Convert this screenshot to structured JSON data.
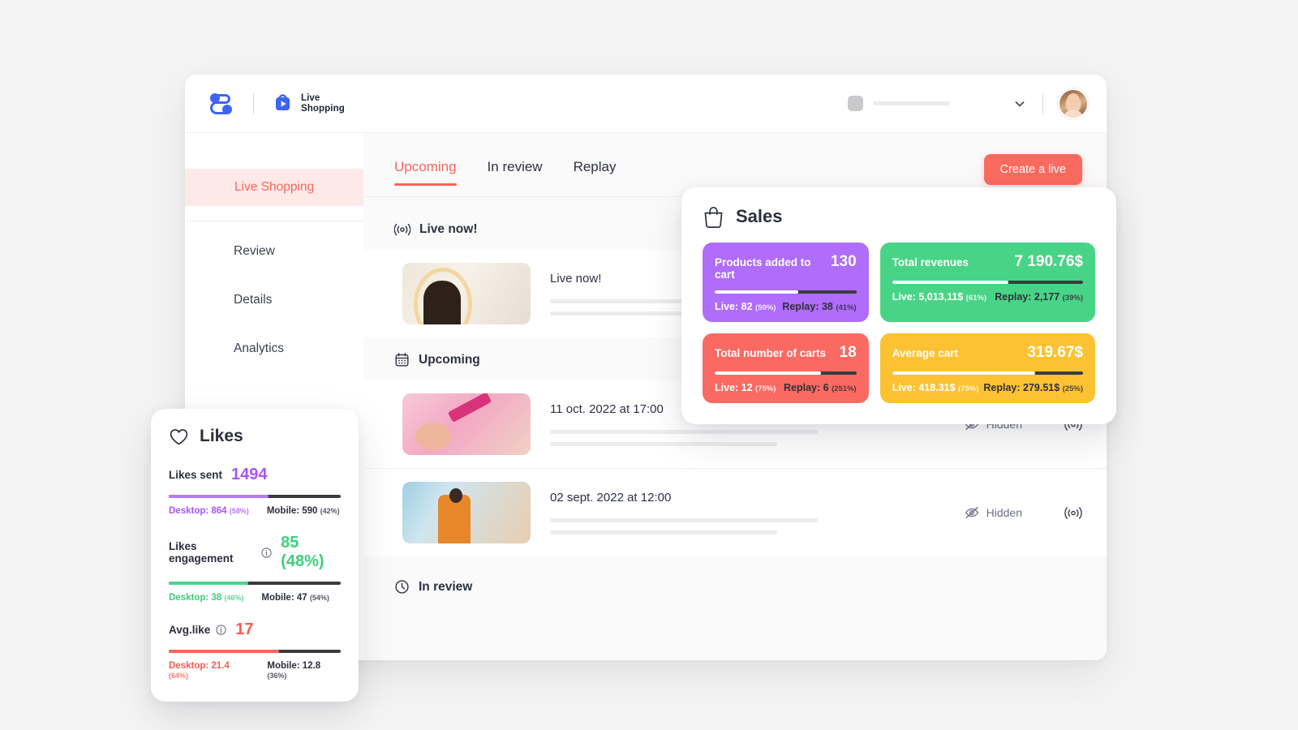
{
  "topbar": {
    "brand_icon": "shopify-style-logo",
    "product_title": "Live\nShopping",
    "product_icon": "live-play-bag-icon",
    "store_selector_icon": "store-thumbnail-placeholder",
    "chevron_icon": "chevron-down-icon",
    "avatar_icon": "user-avatar"
  },
  "sidebar": {
    "primary": {
      "label": "Live Shopping"
    },
    "items": [
      {
        "label": "Review"
      },
      {
        "label": "Details"
      },
      {
        "label": "Analytics"
      }
    ]
  },
  "content": {
    "create_live_label": "Create a live",
    "tabs": [
      {
        "label": "Upcoming",
        "active": true
      },
      {
        "label": "In review",
        "active": false
      },
      {
        "label": "Replay",
        "active": false
      }
    ],
    "live_now_section": {
      "icon": "broadcast-icon",
      "title": "Live now!",
      "row": {
        "title": "Live now!",
        "thumbnail": "woman-with-eyeshadow-palette"
      }
    },
    "upcoming_section": {
      "icon": "calendar-icon",
      "title": "Upcoming",
      "rows": [
        {
          "title": "11 oct. 2022 at 17:00",
          "thumbnail": "pink-makeup-brush-powder",
          "visibility_label": "Hidden",
          "visibility_icon": "eye-off-icon",
          "broadcast_icon": "broadcast-icon"
        },
        {
          "title": "02 sept. 2022 at 12:00",
          "thumbnail": "woman-in-clothing-store",
          "visibility_label": "Hidden",
          "visibility_icon": "eye-off-icon",
          "broadcast_icon": "broadcast-icon"
        }
      ]
    },
    "in_review_section": {
      "icon": "clock-icon",
      "title": "In review"
    }
  },
  "sales_card": {
    "icon": "shopping-bag-icon",
    "title": "Sales",
    "tiles": [
      {
        "label": "Products added to cart",
        "value": "130",
        "color": "#b06cfa",
        "bar_fill_pct": 59,
        "live_label": "Live: 82",
        "live_pct": "(59%)",
        "replay_label": "Replay: 38",
        "replay_pct": "(41%)"
      },
      {
        "label": "Total revenues",
        "value": "7 190.76$",
        "color": "#48d486",
        "bar_fill_pct": 61,
        "live_label": "Live: 5,013,11$",
        "live_pct": "(61%)",
        "replay_label": "Replay: 2,177",
        "replay_pct": "(39%)"
      },
      {
        "label": "Total number of carts",
        "value": "18",
        "color": "#fb6a62",
        "bar_fill_pct": 75,
        "live_label": "Live: 12",
        "live_pct": "(75%)",
        "replay_label": "Replay: 6",
        "replay_pct": "(251%)"
      },
      {
        "label": "Average cart",
        "value": "319.67$",
        "color": "#fdc232",
        "bar_fill_pct": 75,
        "live_label": "Live: 418.31$",
        "live_pct": "(75%)",
        "replay_label": "Replay: 279.51$",
        "replay_pct": "(25%)"
      }
    ]
  },
  "likes_card": {
    "icon": "heart-icon",
    "title": "Likes",
    "metrics": [
      {
        "name": "Likes sent",
        "value": "1494",
        "has_info": false,
        "color": "#a855f7",
        "bar_fill_pct": 58,
        "desktop_label": "Desktop: 864",
        "desktop_pct": "(58%)",
        "mobile_label": "Mobile: 590",
        "mobile_pct": "(42%)"
      },
      {
        "name": "Likes engagement",
        "value": "85 (48%)",
        "has_info": true,
        "info_icon": "info-icon",
        "color": "#3fcd7d",
        "bar_fill_pct": 46,
        "desktop_label": "Desktop: 38",
        "desktop_pct": "(46%)",
        "mobile_label": "Mobile: 47",
        "mobile_pct": "(54%)"
      },
      {
        "name": "Avg.like",
        "value": "17",
        "has_info": true,
        "info_icon": "info-icon",
        "color": "#fa5a4f",
        "bar_fill_pct": 64,
        "desktop_label": "Desktop: 21.4",
        "desktop_pct": "(64%)",
        "mobile_label": "Mobile: 12.8",
        "mobile_pct": "(36%)"
      }
    ]
  },
  "colors": {
    "accent_coral": "#f9655c",
    "purple": "#b06cfa",
    "green": "#48d486",
    "red": "#fb6a62",
    "yellow": "#fdc232",
    "brand_blue": "#3d64f4",
    "page_bg": "#f4f4f4"
  }
}
